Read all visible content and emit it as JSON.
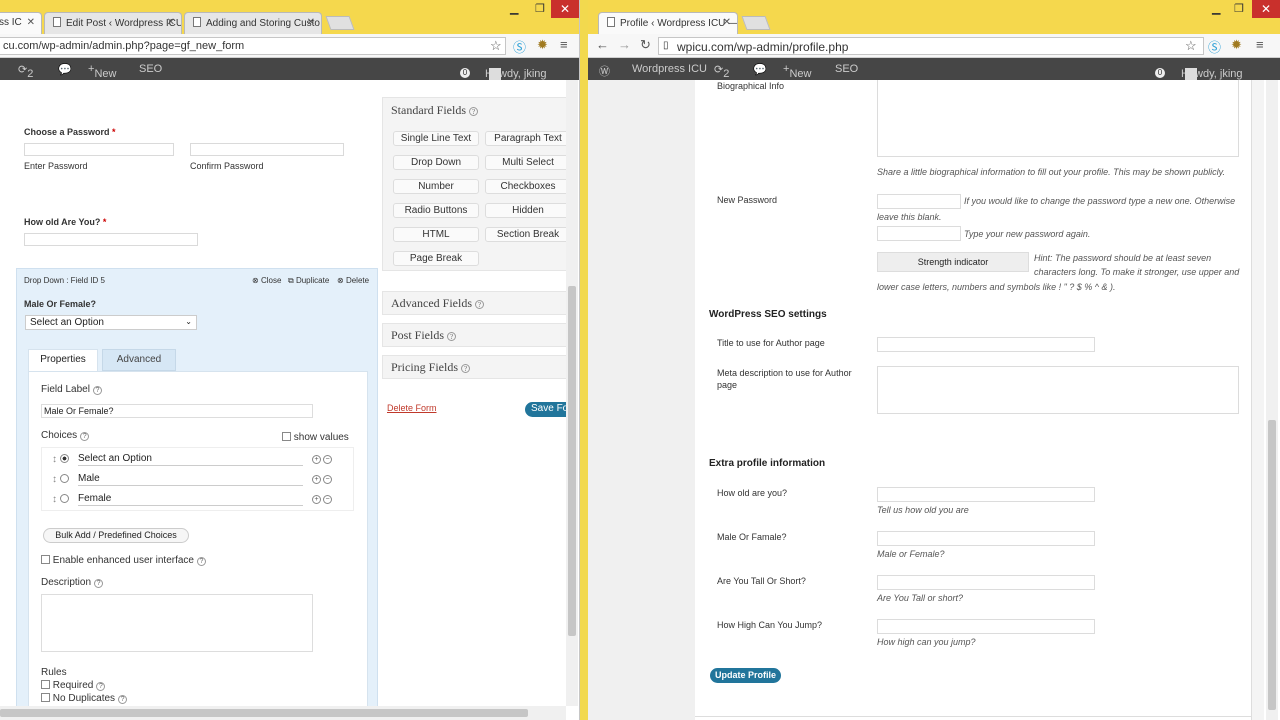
{
  "left": {
    "tabs": [
      {
        "label": "ss IC"
      },
      {
        "label": "Edit Post ‹ Wordpress ICU"
      },
      {
        "label": "Adding and Storing Custo"
      }
    ],
    "url": "cu.com/wp-admin/admin.php?page=gf_new_form",
    "adminbar": {
      "updates": "2",
      "new": "New",
      "seo": "SEO",
      "notif": "0",
      "howdy": "Howdy, jking"
    },
    "form": {
      "password_label": "Choose a Password",
      "required_mark": "*",
      "enter_password": "Enter Password",
      "confirm_password": "Confirm Password",
      "age_label": "How old Are You?",
      "field_header": "Drop Down : Field ID 5",
      "close": "Close",
      "duplicate": "Duplicate",
      "delete": "Delete",
      "gender_label": "Male Or Female?",
      "select_value": "Select an Option",
      "tab_properties": "Properties",
      "tab_advanced": "Advanced",
      "field_label_title": "Field Label",
      "field_label_value": "Male Or Female?",
      "choices_title": "Choices",
      "show_values": "show values",
      "choices": [
        "Select an Option",
        "Male",
        "Female"
      ],
      "bulk_add": "Bulk Add / Predefined Choices",
      "enhanced_ui": "Enable enhanced user interface",
      "description": "Description",
      "rules": "Rules",
      "required": "Required",
      "no_duplicates": "No Duplicates"
    },
    "sidebar": {
      "standard_fields": "Standard Fields",
      "buttons": [
        "Single Line Text",
        "Paragraph Text",
        "Drop Down",
        "Multi Select",
        "Number",
        "Checkboxes",
        "Radio Buttons",
        "Hidden",
        "HTML",
        "Section Break",
        "Page Break"
      ],
      "advanced_fields": "Advanced Fields",
      "post_fields": "Post Fields",
      "pricing_fields": "Pricing Fields",
      "delete_form": "Delete Form",
      "save_form": "Save Fo"
    }
  },
  "right": {
    "tab": "Profile ‹ Wordpress ICU —",
    "url": "wpicu.com/wp-admin/profile.php",
    "adminbar": {
      "site": "Wordpress ICU",
      "updates": "2",
      "new": "New",
      "seo": "SEO",
      "notif": "0",
      "howdy": "Howdy, jking"
    },
    "bio_label": "Biographical Info",
    "bio_hint": "Share a little biographical information to fill out your profile. This may be shown publicly.",
    "new_password": "New Password",
    "pw_hint1a": "If you would like to change the password type a new one. Otherwise",
    "pw_hint1b": "leave this blank.",
    "pw_hint2": "Type your new password again.",
    "strength": "Strength indicator",
    "pw_rule1": "Hint: The password should be at least seven",
    "pw_rule2": "characters long. To make it stronger, use upper and",
    "pw_rule3": "lower case letters, numbers and symbols like ! \" ? $ % ^ & ).",
    "seo_heading": "WordPress SEO settings",
    "seo_title": "Title to use for Author page",
    "seo_meta1": "Meta description to use for Author",
    "seo_meta2": "page",
    "extra_heading": "Extra profile information",
    "extra": [
      {
        "label": "How old are you?",
        "hint": "Tell us how old you are"
      },
      {
        "label": "Male Or Famale?",
        "hint": "Male or Female?"
      },
      {
        "label": "Are You Tall Or Short?",
        "hint": "Are You Tall or short?"
      },
      {
        "label": "How High Can You Jump?",
        "hint": "How high can you jump?"
      }
    ],
    "update": "Update Profile"
  }
}
